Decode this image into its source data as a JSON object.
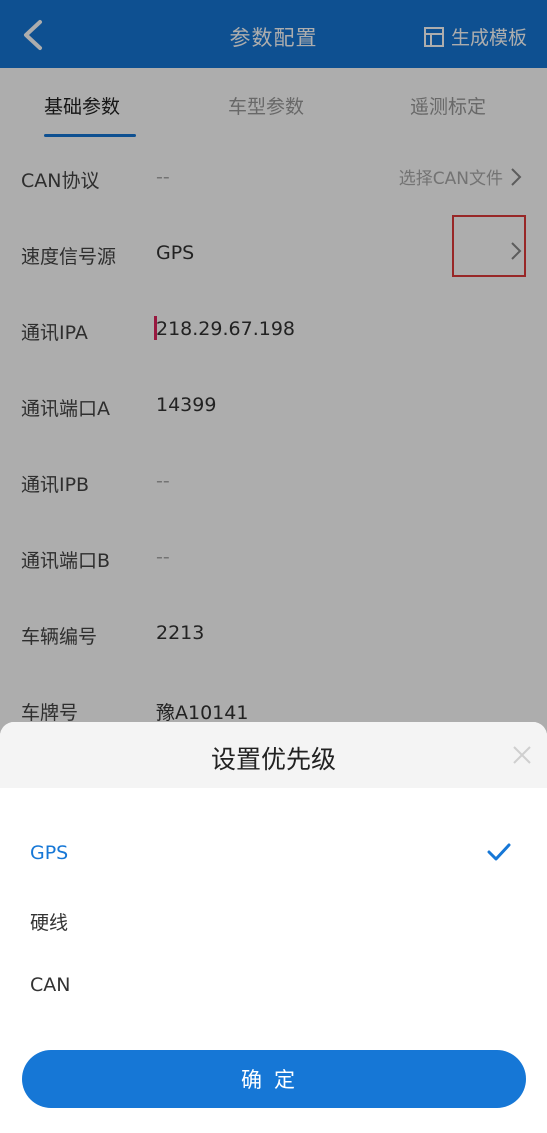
{
  "header": {
    "title": "参数配置",
    "generate_label": "生成模板"
  },
  "tabs": [
    {
      "label": "基础参数",
      "active": true
    },
    {
      "label": "车型参数",
      "active": false
    },
    {
      "label": "遥测标定",
      "active": false
    }
  ],
  "rows": [
    {
      "label": "CAN协议",
      "value": "--",
      "right_text": "选择CAN文件"
    },
    {
      "label": "速度信号源",
      "value": "GPS"
    },
    {
      "label": "通讯IPA",
      "value": "218.29.67.198"
    },
    {
      "label": "通讯端口A",
      "value": "14399"
    },
    {
      "label": "通讯IPB",
      "value": "--"
    },
    {
      "label": "通讯端口B",
      "value": "--"
    },
    {
      "label": "车辆编号",
      "value": "2213"
    },
    {
      "label": "车牌号",
      "value": "豫A10141"
    }
  ],
  "sheet": {
    "title": "设置优先级",
    "options": [
      {
        "label": "GPS",
        "selected": true
      },
      {
        "label": "硬线",
        "selected": false
      },
      {
        "label": "CAN",
        "selected": false
      }
    ],
    "confirm_label": "确定"
  },
  "colors": {
    "accent": "#1677d6",
    "highlight": "#e03a3a"
  }
}
